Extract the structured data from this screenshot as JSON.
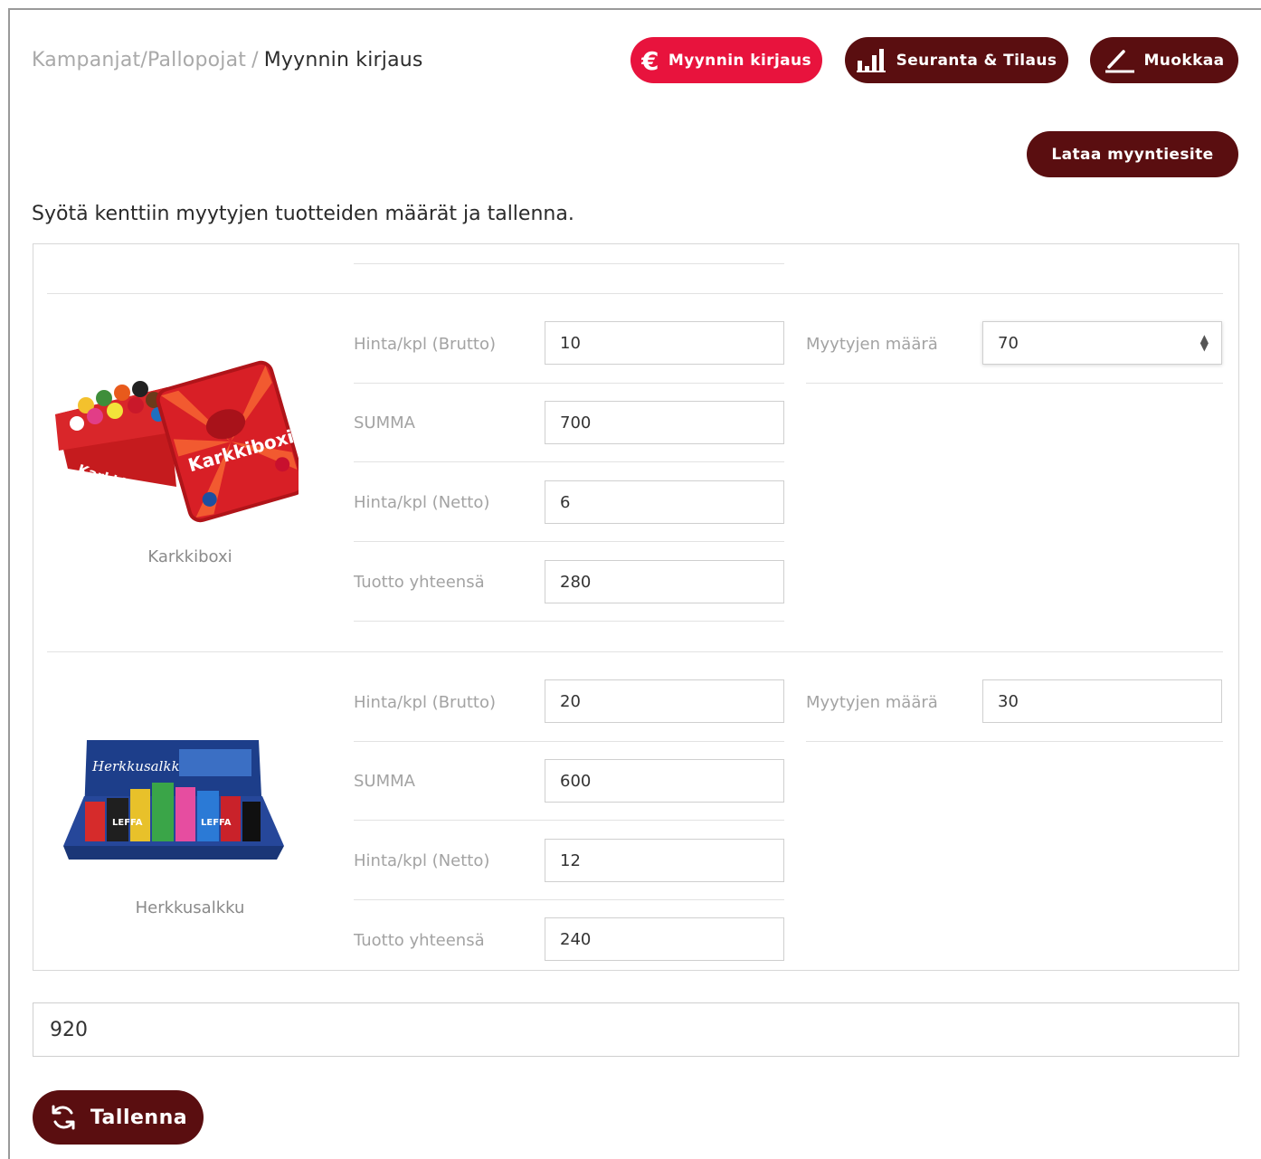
{
  "breadcrumb": {
    "campaigns": "Kampanjat",
    "separator_1": "/",
    "team": "Pallopojat",
    "separator_2": "/",
    "current": "Myynnin kirjaus"
  },
  "header_buttons": {
    "sales_entry": "Myynnin kirjaus",
    "tracking_order": "Seuranta & Tilaus",
    "edit": "Muokkaa",
    "download_brochure": "Lataa myyntiesite"
  },
  "instructions": "Syötä kenttiin myytyjen tuotteiden määrät ja tallenna.",
  "labels": {
    "price_gross": "Hinta/kpl (Brutto)",
    "sum": "SUMMA",
    "price_net": "Hinta/kpl (Netto)",
    "profit_total": "Tuotto yhteensä",
    "sold_quantity": "Myytyjen määrä"
  },
  "products": [
    {
      "name": "Karkkiboxi",
      "image_text": "Karkkiboxi",
      "price_gross": "10",
      "sum": "700",
      "price_net": "6",
      "profit_total": "280",
      "sold_quantity": "70"
    },
    {
      "name": "Herkkusalkku",
      "image_text": "Herkkusalkku",
      "price_gross": "20",
      "sum": "600",
      "price_net": "12",
      "profit_total": "240",
      "sold_quantity": "30"
    }
  ],
  "total_profit": "920",
  "save_label": "Tallenna",
  "colors": {
    "accent_red": "#e8133d",
    "dark_maroon": "#5a0e10"
  },
  "icons": {
    "sales_entry": "euro-icon",
    "tracking_order": "bar-chart-icon",
    "edit": "pencil-icon",
    "save": "refresh-icon",
    "quantity": "spinner-arrows-icon"
  }
}
